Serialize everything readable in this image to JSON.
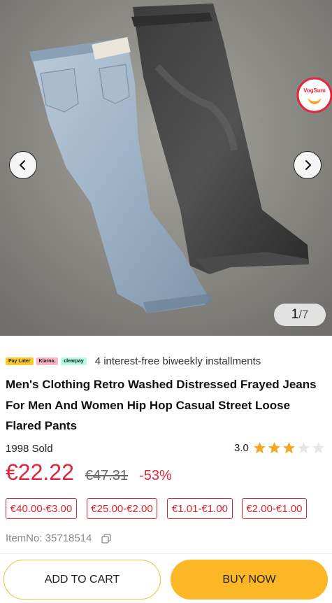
{
  "gallery": {
    "image_name": "product-photo-jeans",
    "current": "1",
    "separator": "/",
    "total": "7",
    "badge_text": "VogSum"
  },
  "payment": {
    "chips": [
      "Pay Later",
      "Klarna.",
      "clearpay"
    ],
    "text": "4 interest-free biweekly installments"
  },
  "product": {
    "title": "Men's Clothing Retro Washed Distressed Frayed Jeans For Men And Women Hip Hop Casual Street Loose Flared Pants",
    "sold": "1998 Sold",
    "rating": "3.0",
    "rating_stars": 3,
    "price": "€22.22",
    "original_price": "€47.31",
    "discount": "-53%",
    "item_no": "ItemNo: 35718514"
  },
  "coupons": [
    "€40.00-€3.00",
    "€25.00-€2.00",
    "€1.01-€1.00",
    "€2.00-€1.00"
  ],
  "actions": {
    "add_to_cart": "ADD TO CART",
    "buy_now": "BUY NOW"
  },
  "colors": {
    "accent_red": "#e0263a",
    "button_yellow": "#fbb726",
    "star_filled": "#f5a623",
    "star_empty": "#e6e6e6"
  }
}
